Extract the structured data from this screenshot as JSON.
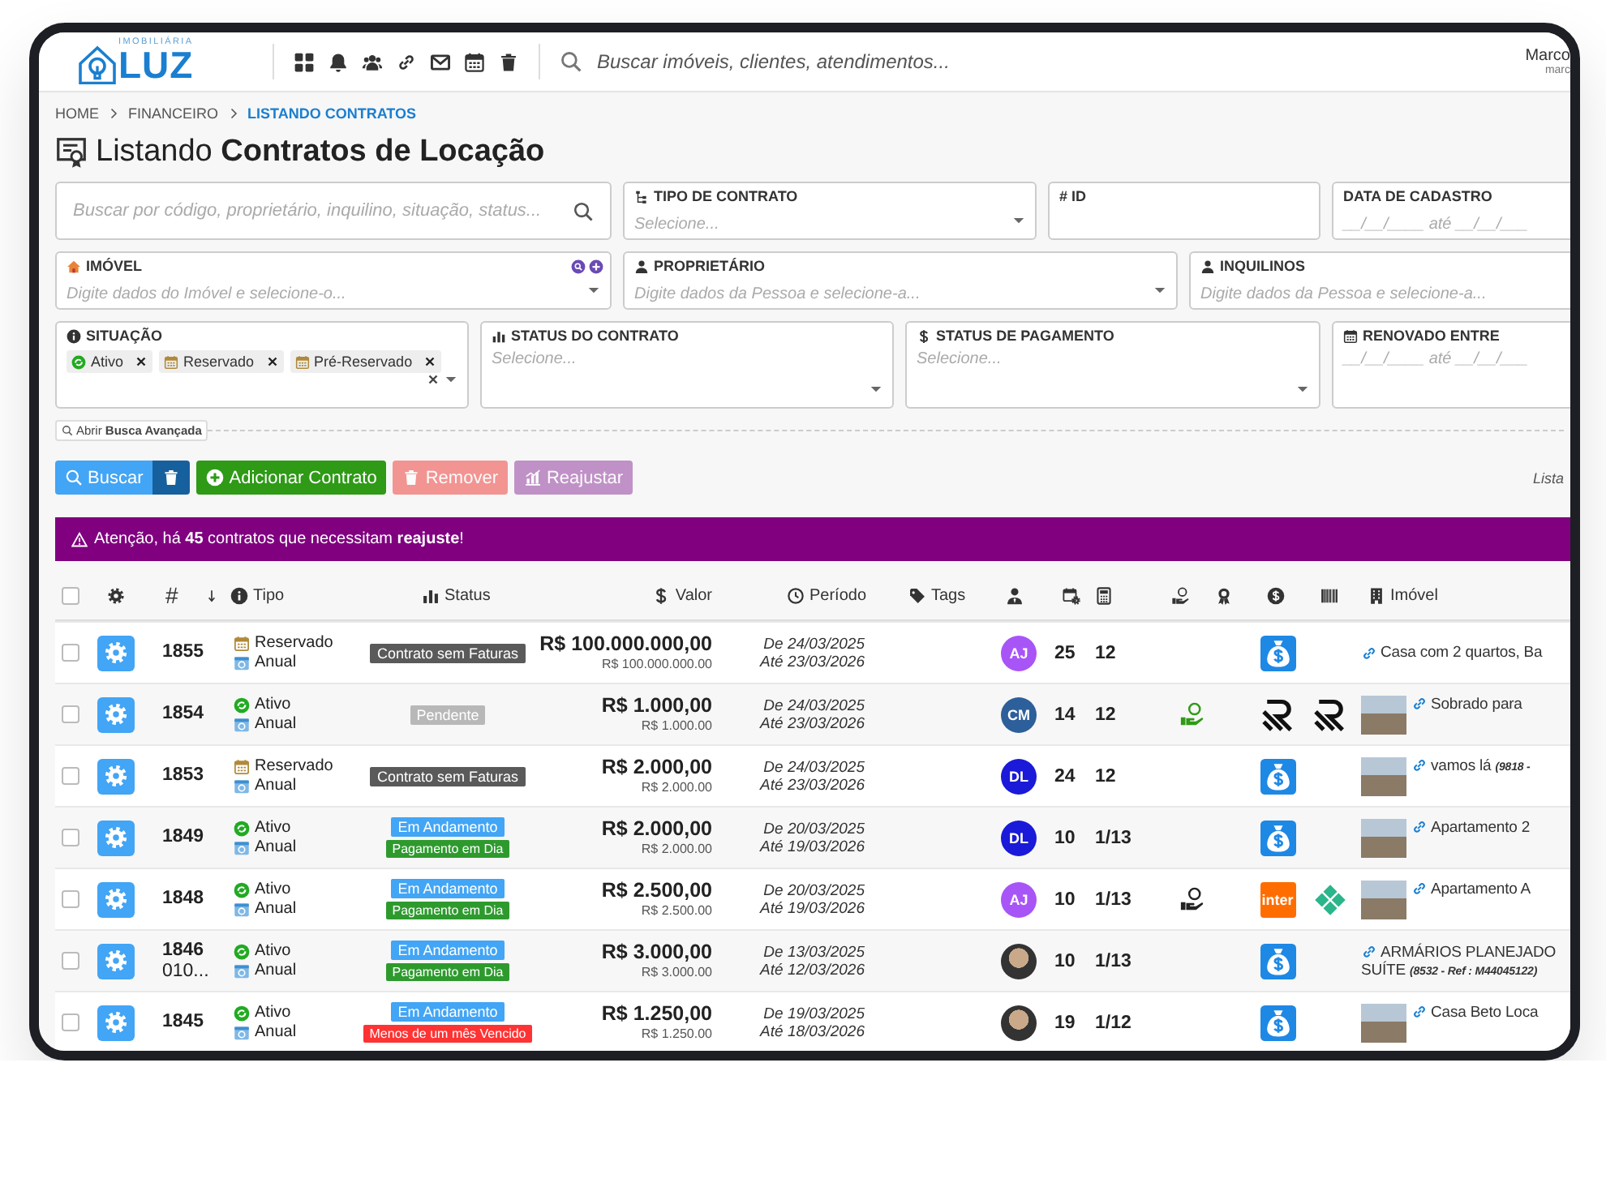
{
  "topbar": {
    "logo": {
      "caption": "IMOBILIÁRIA",
      "name": "LUZ"
    },
    "search": {
      "placeholder": "Buscar imóveis, clientes, atendimentos..."
    },
    "user": {
      "name": "Marco",
      "subtitle": "marc"
    }
  },
  "breadcrumb": [
    {
      "label": "HOME",
      "selected": false
    },
    {
      "label": "FINANCEIRO",
      "selected": false
    },
    {
      "label": "LISTANDO CONTRATOS",
      "selected": true
    }
  ],
  "title": "Listando **Contratos de Locação**",
  "filters": [
    [
      {
        "kind": "search",
        "placeholder": "Buscar por código, proprietário, inquilino, situação, status..."
      },
      {
        "kind": "select",
        "label": "TIPO DE CONTRATO",
        "placeholder": "Selecione..."
      },
      {
        "kind": "text",
        "label": "# ID"
      },
      {
        "kind": "text",
        "label": "DATA DE CADASTRO",
        "placeholder": "__/__/____  até  __/__/___"
      }
    ],
    [
      {
        "kind": "select",
        "label": "IMÓVEL",
        "placeholder": "Digite dados do Imóvel e selecione-o...",
        "actions": true
      },
      {
        "kind": "select",
        "label": "PROPRIETÁRIO",
        "placeholder": "Digite dados da Pessoa e selecione-a..."
      },
      {
        "kind": "text",
        "label": "INQUILINOS",
        "placeholder": "Digite dados da Pessoa e selecione-a..."
      }
    ],
    [
      {
        "kind": "tags",
        "label": "SITUAÇÃO",
        "tags": [
          {
            "kind": "active",
            "label": "Ativo"
          },
          {
            "kind": "reserved",
            "label": "Reservado"
          },
          {
            "kind": "reserved",
            "label": "Pré-Reservado"
          }
        ]
      },
      {
        "kind": "select",
        "label": "STATUS DO CONTRATO",
        "placeholder": "Selecione..."
      },
      {
        "kind": "select",
        "label": "STATUS DE PAGAMENTO",
        "placeholder": "Selecione..."
      },
      {
        "kind": "text",
        "label": "RENOVADO ENTRE",
        "placeholder": "__/__/____  até  __/__/___"
      }
    ]
  ],
  "advanced": "Abrir **Busca Avançada**",
  "actions": [
    {
      "kind": "search",
      "label": "Buscar",
      "disabled": false
    },
    {
      "kind": "clear",
      "disabled": false
    },
    {
      "kind": "add",
      "label": "Adicionar Contrato",
      "disabled": false
    },
    {
      "kind": "remove",
      "label": "Remover",
      "disabled": true
    },
    {
      "kind": "adjust",
      "label": "Reajustar",
      "disabled": true
    }
  ],
  "list_label": "Lista",
  "alert": "Atenção, há **45** contratos que necessitam **reajuste**!",
  "table": {
    "all_selected": false,
    "columns": {
      "id": "#",
      "type": "Tipo",
      "status": "Status",
      "value": "Valor",
      "period": "Período",
      "tags": "Tags",
      "property": "Imóvel"
    },
    "rows": [
      {
        "selected": false,
        "id": "1855",
        "situation": {
          "kind": "reserved",
          "label": "Reservado"
        },
        "type": "Anual",
        "badges": [
          {
            "kind": "no-invoices",
            "label": "Contrato sem Faturas"
          }
        ],
        "value": "R$ 100.000.000,00",
        "value_raw": "R$ 100.000.000.00",
        "start": "De 24/03/2025",
        "end": "Até 23/03/2026",
        "avatar": {
          "kind": "initials",
          "initials": "AJ",
          "color": "#a855f7"
        },
        "count_1": "25",
        "count_2": "12",
        "banks": [
          {
            "kind": "bag"
          }
        ],
        "photo": false,
        "property": "Casa com 2 quartos, Ba"
      },
      {
        "selected": false,
        "id": "1854",
        "situation": {
          "kind": "active",
          "label": "Ativo"
        },
        "type": "Anual",
        "badges": [
          {
            "kind": "pending",
            "label": "Pendente"
          }
        ],
        "value": "R$ 1.000,00",
        "value_raw": "R$ 1.000.00",
        "start": "De 24/03/2025",
        "end": "Até 23/03/2026",
        "avatar": {
          "kind": "initials",
          "initials": "CM",
          "color": "#2d5f9a"
        },
        "count_1": "14",
        "count_2": "12",
        "payout": {
          "highlighted": true
        },
        "banks": [
          {
            "kind": "r-logo"
          },
          {
            "kind": "r-logo"
          }
        ],
        "photo": true,
        "property": "Sobrado para"
      },
      {
        "selected": false,
        "id": "1853",
        "situation": {
          "kind": "reserved",
          "label": "Reservado"
        },
        "type": "Anual",
        "badges": [
          {
            "kind": "no-invoices",
            "label": "Contrato sem Faturas"
          }
        ],
        "value": "R$ 2.000,00",
        "value_raw": "R$ 2.000.00",
        "start": "De 24/03/2025",
        "end": "Até 23/03/2026",
        "avatar": {
          "kind": "initials",
          "initials": "DL",
          "color": "#1a1ad8"
        },
        "count_1": "24",
        "count_2": "12",
        "banks": [
          {
            "kind": "bag"
          }
        ],
        "photo": true,
        "property": "vamos lá",
        "ref": "(9818 -"
      },
      {
        "selected": false,
        "id": "1849",
        "situation": {
          "kind": "active",
          "label": "Ativo"
        },
        "type": "Anual",
        "badges": [
          {
            "kind": "progress",
            "label": "Em Andamento"
          },
          {
            "kind": "on-time",
            "label": "Pagamento em Dia"
          }
        ],
        "value": "R$ 2.000,00",
        "value_raw": "R$ 2.000.00",
        "start": "De 20/03/2025",
        "end": "Até 19/03/2026",
        "avatar": {
          "kind": "initials",
          "initials": "DL",
          "color": "#1a1ad8"
        },
        "count_1": "10",
        "count_2": "1/13",
        "banks": [
          {
            "kind": "bag"
          }
        ],
        "photo": true,
        "property": "Apartamento 2"
      },
      {
        "selected": false,
        "id": "1848",
        "situation": {
          "kind": "active",
          "label": "Ativo"
        },
        "type": "Anual",
        "badges": [
          {
            "kind": "progress",
            "label": "Em Andamento"
          },
          {
            "kind": "on-time",
            "label": "Pagamento em Dia"
          }
        ],
        "value": "R$ 2.500,00",
        "value_raw": "R$ 2.500.00",
        "start": "De 20/03/2025",
        "end": "Até 19/03/2026",
        "avatar": {
          "kind": "initials",
          "initials": "AJ",
          "color": "#a855f7"
        },
        "count_1": "10",
        "count_2": "1/13",
        "payout": {
          "highlighted": false
        },
        "banks": [
          {
            "kind": "inter",
            "label": "inter"
          },
          {
            "kind": "diamond"
          }
        ],
        "photo": true,
        "property": "Apartamento A"
      },
      {
        "selected": false,
        "id": "1846",
        "id_extra": "010...",
        "situation": {
          "kind": "active",
          "label": "Ativo"
        },
        "type": "Anual",
        "badges": [
          {
            "kind": "progress",
            "label": "Em Andamento"
          },
          {
            "kind": "on-time",
            "label": "Pagamento em Dia"
          }
        ],
        "value": "R$ 3.000,00",
        "value_raw": "R$ 3.000.00",
        "start": "De 13/03/2025",
        "end": "Até 12/03/2026",
        "avatar": {
          "kind": "photo"
        },
        "count_1": "10",
        "count_2": "1/13",
        "banks": [
          {
            "kind": "bag"
          }
        ],
        "photo": false,
        "property": "ARMÁRIOS PLANEJADO",
        "property_line_2": "SUÍTE",
        "ref": "(8532 - Ref : M44045122)"
      },
      {
        "selected": false,
        "id": "1845",
        "situation": {
          "kind": "active",
          "label": "Ativo"
        },
        "type": "Anual",
        "badges": [
          {
            "kind": "progress",
            "label": "Em Andamento"
          },
          {
            "kind": "overdue",
            "label": "Menos de um mês Vencido"
          }
        ],
        "value": "R$ 1.250,00",
        "value_raw": "R$ 1.250.00",
        "start": "De 19/03/2025",
        "end": "Até 18/03/2026",
        "avatar": {
          "kind": "photo"
        },
        "count_1": "19",
        "count_2": "1/12",
        "banks": [
          {
            "kind": "bag"
          }
        ],
        "photo": true,
        "property": "Casa Beto Loca"
      }
    ]
  }
}
